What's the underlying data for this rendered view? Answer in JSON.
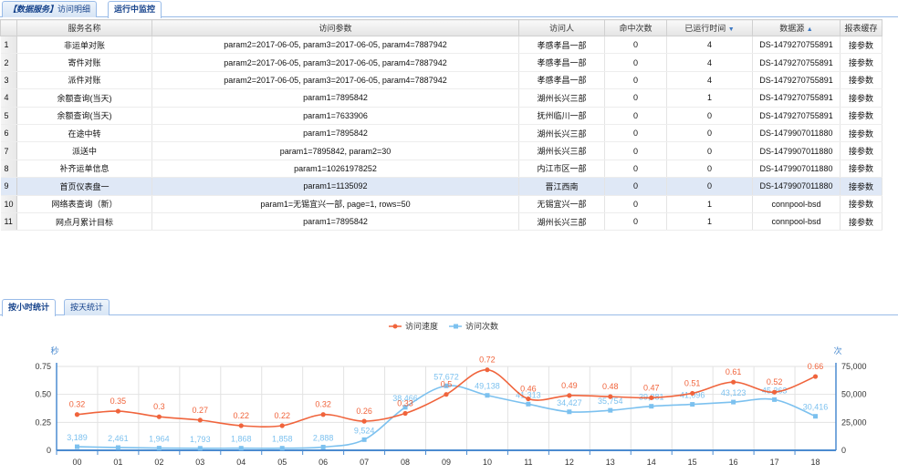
{
  "top_tabs": [
    {
      "prefix": "【数据服务】",
      "label": "访问明细"
    },
    {
      "label": "运行中监控"
    }
  ],
  "table": {
    "columns": [
      "服务名称",
      "访问参数",
      "访问人",
      "命中次数",
      "已运行时间",
      "数据源",
      "报表缓存"
    ],
    "sort_icon": "▼",
    "sort_icon_up": "▲",
    "rows": [
      {
        "n": "1",
        "name": "非运单对账",
        "params": "param2=2017-06-05, param3=2017-06-05, param4=7887942",
        "user": "孝感孝昌一部",
        "hits": "0",
        "time": "4",
        "ds": "DS-1479270755891",
        "cache": "接参数"
      },
      {
        "n": "2",
        "name": "寄件对账",
        "params": "param2=2017-06-05, param3=2017-06-05, param4=7887942",
        "user": "孝感孝昌一部",
        "hits": "0",
        "time": "4",
        "ds": "DS-1479270755891",
        "cache": "接参数"
      },
      {
        "n": "3",
        "name": "派件对账",
        "params": "param2=2017-06-05, param3=2017-06-05, param4=7887942",
        "user": "孝感孝昌一部",
        "hits": "0",
        "time": "4",
        "ds": "DS-1479270755891",
        "cache": "接参数"
      },
      {
        "n": "4",
        "name": "余额查询(当天)",
        "params": "param1=7895842",
        "user": "湖州长兴三部",
        "hits": "0",
        "time": "1",
        "ds": "DS-1479270755891",
        "cache": "接参数"
      },
      {
        "n": "5",
        "name": "余额查询(当天)",
        "params": "param1=7633906",
        "user": "抚州临川一部",
        "hits": "0",
        "time": "0",
        "ds": "DS-1479270755891",
        "cache": "接参数"
      },
      {
        "n": "6",
        "name": "在途中转",
        "params": "param1=7895842",
        "user": "湖州长兴三部",
        "hits": "0",
        "time": "0",
        "ds": "DS-1479907011880",
        "cache": "接参数"
      },
      {
        "n": "7",
        "name": "派送中",
        "params": "param1=7895842, param2=30",
        "user": "湖州长兴三部",
        "hits": "0",
        "time": "0",
        "ds": "DS-1479907011880",
        "cache": "接参数"
      },
      {
        "n": "8",
        "name": "补齐运单信息",
        "params": "param1=10261978252",
        "user": "内江市区一部",
        "hits": "0",
        "time": "0",
        "ds": "DS-1479907011880",
        "cache": "接参数"
      },
      {
        "n": "9",
        "name": "首页仪表盘一",
        "params": "param1=1135092",
        "user": "晋江西南",
        "hits": "0",
        "time": "0",
        "ds": "DS-1479907011880",
        "cache": "接参数"
      },
      {
        "n": "10",
        "name": "网络表查询（新）",
        "params": "param1=无锡宜兴一部, page=1, rows=50",
        "user": "无锡宜兴一部",
        "hits": "0",
        "time": "1",
        "ds": "connpool-bsd",
        "cache": "接参数"
      },
      {
        "n": "11",
        "name": "网点月累计目标",
        "params": "param1=7895842",
        "user": "湖州长兴三部",
        "hits": "0",
        "time": "1",
        "ds": "connpool-bsd",
        "cache": "接参数"
      }
    ]
  },
  "bottom_tabs": [
    "按小时统计",
    "按天统计"
  ],
  "colors": {
    "speed": "#f0643c",
    "count": "#7cc1ef",
    "axis": "#4b8bd0",
    "tab_border": "#99bbe8",
    "selected_row": "#dfe8f6"
  },
  "chart_data": {
    "type": "line",
    "x": [
      "00",
      "01",
      "02",
      "03",
      "04",
      "05",
      "06",
      "07",
      "08",
      "09",
      "10",
      "11",
      "12",
      "13",
      "14",
      "15",
      "16",
      "17",
      "18"
    ],
    "series": [
      {
        "name": "访问速度",
        "axis": "left",
        "values": [
          0.32,
          0.35,
          0.3,
          0.27,
          0.22,
          0.22,
          0.32,
          0.26,
          0.33,
          0.5,
          0.72,
          0.46,
          0.49,
          0.48,
          0.47,
          0.51,
          0.61,
          0.52,
          0.66
        ],
        "labels": [
          "0.32",
          "0.35",
          "0.3",
          "0.27",
          "0.22",
          "0.22",
          "0.32",
          "0.26",
          "0.33",
          "0.5",
          "0.72",
          "0.46",
          "0.49",
          "0.48",
          "0.47",
          "0.51",
          "0.61",
          "0.52",
          "0.66"
        ]
      },
      {
        "name": "访问次数",
        "axis": "right",
        "values": [
          3189,
          2461,
          1964,
          1793,
          1868,
          1858,
          2888,
          9524,
          38466,
          57672,
          49138,
          41313,
          34427,
          35754,
          39381,
          41096,
          43123,
          45363,
          30416
        ],
        "labels": [
          "3,189",
          "2,461",
          "1,964",
          "1,793",
          "1,868",
          "1,858",
          "2,888",
          "9,524",
          "38,466",
          "57,672",
          "49,138",
          "41,313",
          "34,427",
          "35,754",
          "39,381",
          "41,096",
          "43,123",
          "45,363",
          "30,416"
        ]
      }
    ],
    "ylabel": "秒",
    "y2label": "次",
    "ylim": [
      0,
      0.75
    ],
    "y2lim": [
      0,
      75000
    ],
    "yticks": [
      "0",
      "0.25",
      "0.50",
      "0.75"
    ],
    "y2ticks": [
      "0",
      "25,000",
      "50,000",
      "75,000"
    ],
    "grid": true,
    "legend": "top-center"
  }
}
